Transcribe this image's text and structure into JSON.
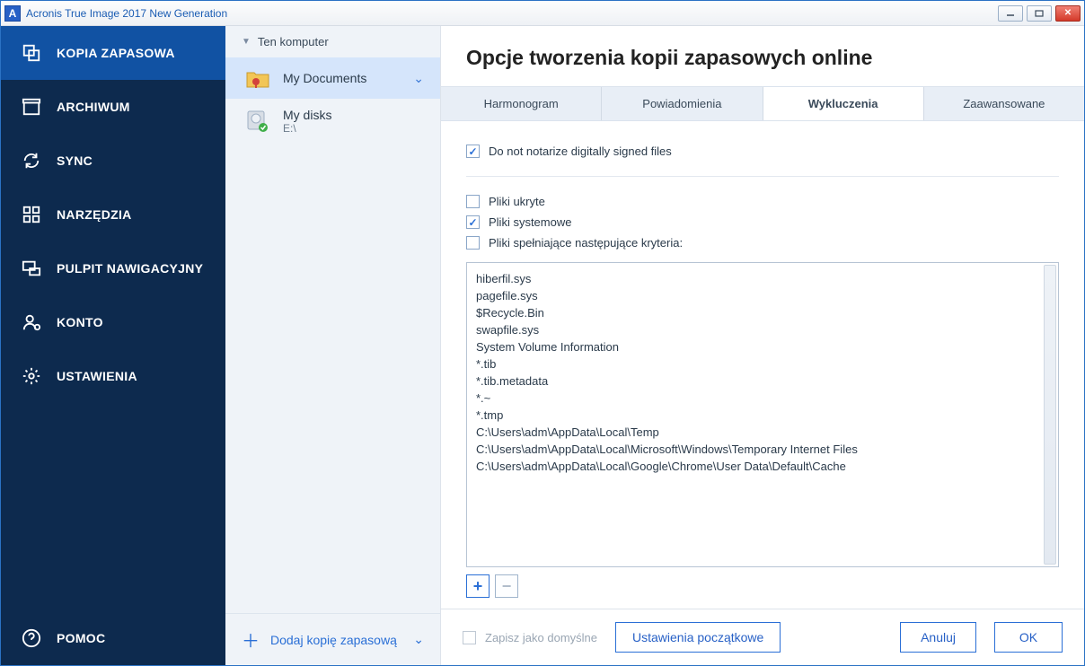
{
  "window": {
    "title": "Acronis True Image 2017 New Generation"
  },
  "leftnav": {
    "items": [
      {
        "label": "KOPIA ZAPASOWA",
        "icon": "copy"
      },
      {
        "label": "ARCHIWUM",
        "icon": "archive"
      },
      {
        "label": "SYNC",
        "icon": "sync"
      },
      {
        "label": "NARZĘDZIA",
        "icon": "tools"
      },
      {
        "label": "PULPIT NAWIGACYJNY",
        "icon": "dashboard"
      },
      {
        "label": "KONTO",
        "icon": "account"
      },
      {
        "label": "USTAWIENIA",
        "icon": "settings"
      }
    ],
    "help": "POMOC"
  },
  "midcol": {
    "group": "Ten komputer",
    "items": [
      {
        "label": "My Documents",
        "sub": "",
        "selected": true
      },
      {
        "label": "My disks",
        "sub": "E:\\",
        "selected": false
      }
    ],
    "add": "Dodaj kopię zapasową"
  },
  "main": {
    "title": "Opcje tworzenia kopii zapasowych online",
    "tabs": [
      "Harmonogram",
      "Powiadomienia",
      "Wykluczenia",
      "Zaawansowane"
    ],
    "activeTab": 2,
    "notarize": {
      "label": "Do not notarize digitally signed files",
      "checked": true
    },
    "opts": [
      {
        "label": "Pliki ukryte",
        "checked": false
      },
      {
        "label": "Pliki systemowe",
        "checked": true
      },
      {
        "label": "Pliki spełniające następujące kryteria:",
        "checked": false
      }
    ],
    "criteria": [
      "hiberfil.sys",
      "pagefile.sys",
      "$Recycle.Bin",
      "swapfile.sys",
      "System Volume Information",
      "*.tib",
      "*.tib.metadata",
      "*.~",
      "*.tmp",
      "C:\\Users\\adm\\AppData\\Local\\Temp",
      "C:\\Users\\adm\\AppData\\Local\\Microsoft\\Windows\\Temporary Internet Files",
      "C:\\Users\\adm\\AppData\\Local\\Google\\Chrome\\User Data\\Default\\Cache"
    ]
  },
  "footer": {
    "saveDefault": "Zapisz jako domyślne",
    "initial": "Ustawienia początkowe",
    "cancel": "Anuluj",
    "ok": "OK"
  }
}
